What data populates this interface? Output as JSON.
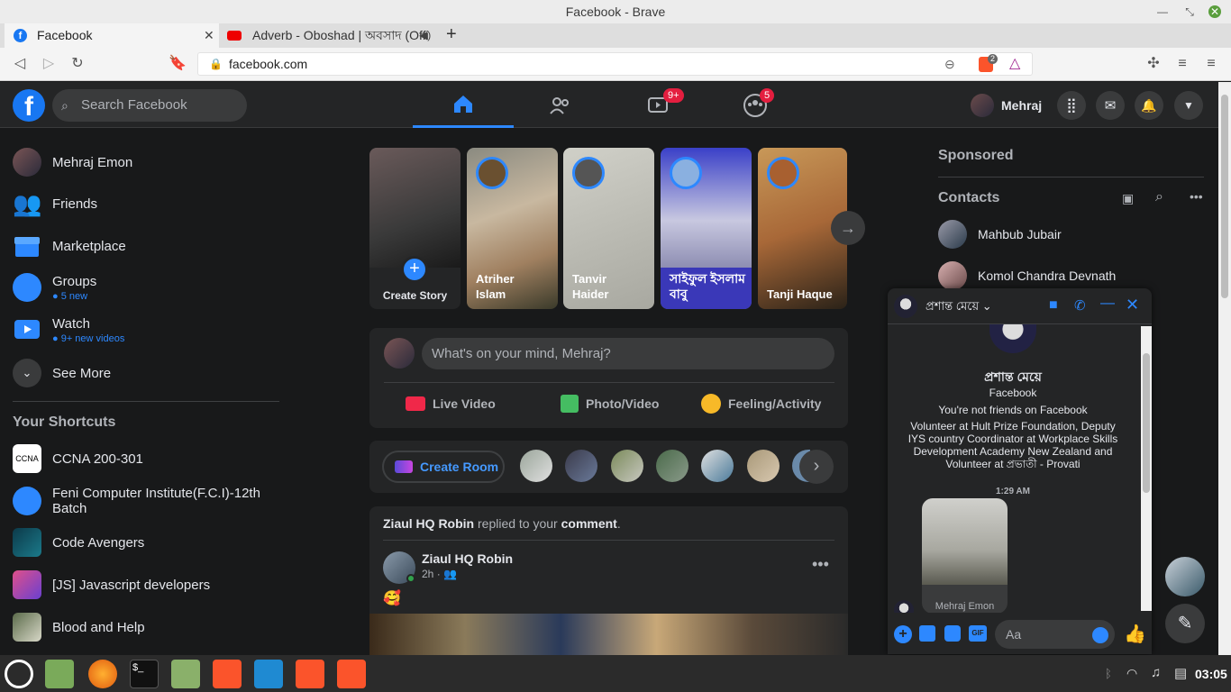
{
  "window": {
    "title": "Facebook - Brave"
  },
  "tabs": [
    {
      "label": "Facebook",
      "favicon": "facebook-icon"
    },
    {
      "label": "Adverb - Oboshad | অবসাদ (Offi",
      "favicon": "youtube-icon"
    }
  ],
  "address_bar": {
    "url": "facebook.com",
    "shield_count": "2"
  },
  "fb": {
    "search_placeholder": "Search Facebook",
    "watch_badge": "9+",
    "groups_badge": "5",
    "profile_name": "Mehraj"
  },
  "left_nav": {
    "items": [
      {
        "label": "Mehraj Emon",
        "sub": ""
      },
      {
        "label": "Friends",
        "sub": ""
      },
      {
        "label": "Marketplace",
        "sub": ""
      },
      {
        "label": "Groups",
        "sub": "5 new"
      },
      {
        "label": "Watch",
        "sub": "9+ new videos"
      },
      {
        "label": "See More",
        "sub": ""
      }
    ],
    "shortcuts_title": "Your Shortcuts",
    "shortcuts": [
      {
        "label": "CCNA 200-301",
        "icon_text": "CCNA"
      },
      {
        "label": "Feni Computer Institute(F.C.I)-12th Batch"
      },
      {
        "label": "Code Avengers"
      },
      {
        "label": "[JS] Javascript developers"
      },
      {
        "label": "Blood and Help"
      }
    ]
  },
  "stories": [
    {
      "label": "Create Story"
    },
    {
      "label": "Atriher Islam"
    },
    {
      "label": "Tanvir Haider"
    },
    {
      "label": "সাইফুল ইসলাম বাবু"
    },
    {
      "label": "Tanji Haque"
    }
  ],
  "composer": {
    "placeholder": "What's on your mind, Mehraj?",
    "live": "Live Video",
    "photo": "Photo/Video",
    "feeling": "Feeling/Activity"
  },
  "rooms": {
    "create": "Create Room"
  },
  "post": {
    "notice_actor": "Ziaul HQ Robin",
    "notice_mid": "replied to your",
    "notice_obj": "comment",
    "author": "Ziaul HQ Robin",
    "time": "2h",
    "content": "🥰"
  },
  "right": {
    "sponsored": "Sponsored",
    "contacts_title": "Contacts",
    "contacts": [
      "Mahbub Jubair",
      "Komol Chandra Devnath"
    ]
  },
  "chat": {
    "name": "প্রশান্ত মেয়ে",
    "profile_name": "প্রশান্ত মেয়ে",
    "platform": "Facebook",
    "not_friends": "You're not friends on Facebook",
    "bio": "Volunteer at Hult Prize Foundation, Deputy IYS country Coordinator at Workplace Skills Development Academy New Zealand and Volunteer at প্রভাতী - Provati",
    "time": "1:29 AM",
    "shared_name": "Mehraj Emon",
    "input_placeholder": "Aa",
    "gif": "GIF"
  },
  "taskbar": {
    "time": "03:05"
  },
  "colors": {
    "accent": "#2d88ff",
    "fb_blue": "#1877f2",
    "badge": "#e41e3f",
    "surface": "#242526",
    "bg": "#18191a"
  }
}
